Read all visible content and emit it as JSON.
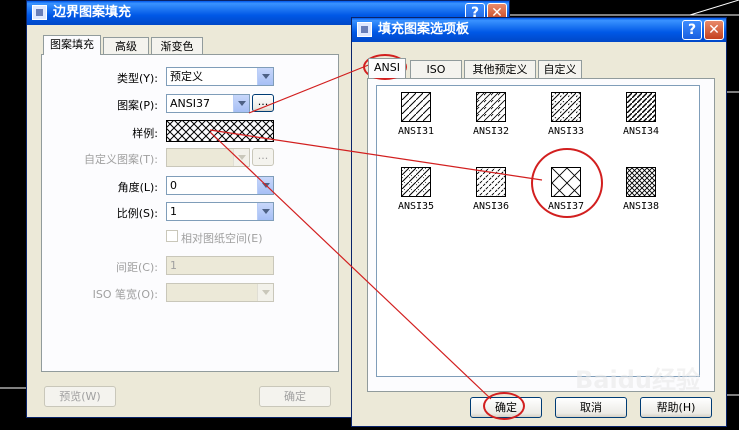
{
  "left_dialog": {
    "title": "边界图案填充",
    "tabs": [
      "图案填充",
      "高级",
      "渐变色"
    ],
    "fields": {
      "type_label": "类型(Y):",
      "type_value": "预定义",
      "pattern_label": "图案(P):",
      "pattern_value": "ANSI37",
      "pattern_browse": "...",
      "sample_label": "样例:",
      "custom_label": "自定义图案(T):",
      "custom_browse": "...",
      "angle_label": "角度(L):",
      "angle_value": "0",
      "scale_label": "比例(S):",
      "scale_value": "1",
      "relative_label": "相对图纸空间(E)",
      "spacing_label": "间距(C):",
      "spacing_value": "1",
      "iso_label": "ISO 笔宽(O):"
    },
    "buttons": {
      "preview": "预览(W)",
      "ok": "确定"
    }
  },
  "right_dialog": {
    "title": "填充图案选项板",
    "tabs": [
      "ANSI",
      "ISO",
      "其他预定义",
      "自定义"
    ],
    "patterns": [
      "ANSI31",
      "ANSI32",
      "ANSI33",
      "ANSI34",
      "ANSI35",
      "ANSI36",
      "ANSI37",
      "ANSI38"
    ],
    "selected_pattern": "ANSI37",
    "buttons": {
      "ok": "确定",
      "cancel": "取消",
      "help": "帮助(H)"
    }
  },
  "watermark": "Baidu经验",
  "annotation_color": "#d21f1f"
}
